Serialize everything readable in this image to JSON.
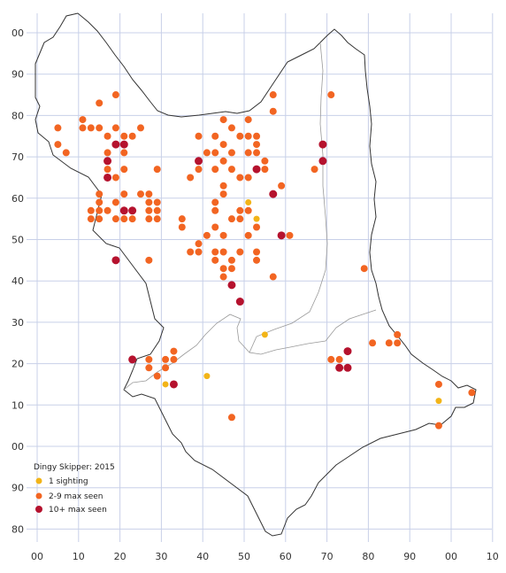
{
  "map": {
    "title": "Dingy Skipper:  2015",
    "x_ticks": [
      "00",
      "10",
      "20",
      "30",
      "40",
      "50",
      "60",
      "70",
      "80",
      "90",
      "00",
      "10"
    ],
    "y_ticks": [
      "00",
      "90",
      "80",
      "70",
      "60",
      "50",
      "40",
      "30",
      "20",
      "10",
      "00",
      "90",
      "80"
    ],
    "x_tick_values": [
      0,
      10,
      20,
      30,
      40,
      50,
      60,
      70,
      80,
      90,
      100,
      110
    ],
    "y_tick_values": [
      100,
      90,
      80,
      70,
      60,
      50,
      40,
      30,
      20,
      10,
      0,
      -10,
      -20
    ],
    "x_range": [
      -5,
      113
    ],
    "y_range": [
      -23,
      105
    ]
  },
  "legend": {
    "title": "Dingy Skipper:  2015",
    "items": [
      {
        "key": "one",
        "label": "1 sighting",
        "color": "#f2b418"
      },
      {
        "key": "few",
        "label": "2-9 max seen",
        "color": "#f26522"
      },
      {
        "key": "many",
        "label": "10+ max seen",
        "color": "#b5122e"
      }
    ]
  },
  "chart_data": {
    "type": "scatter",
    "title": "Dingy Skipper:  2015",
    "series": [
      {
        "name": "1 sighting",
        "color": "#f2b418",
        "points": [
          [
            51,
            59
          ],
          [
            53,
            55
          ],
          [
            55,
            27
          ],
          [
            41,
            17
          ],
          [
            31,
            15
          ],
          [
            97,
            11
          ]
        ]
      },
      {
        "name": "2-9 max seen",
        "color": "#f26522",
        "points": [
          [
            5,
            77
          ],
          [
            5,
            73
          ],
          [
            7,
            71
          ],
          [
            11,
            79
          ],
          [
            11,
            77
          ],
          [
            13,
            77
          ],
          [
            15,
            83
          ],
          [
            15,
            77
          ],
          [
            17,
            75
          ],
          [
            17,
            71
          ],
          [
            17,
            67
          ],
          [
            19,
            85
          ],
          [
            19,
            77
          ],
          [
            19,
            65
          ],
          [
            21,
            75
          ],
          [
            21,
            71
          ],
          [
            21,
            67
          ],
          [
            21,
            61
          ],
          [
            23,
            75
          ],
          [
            25,
            77
          ],
          [
            25,
            61
          ],
          [
            27,
            61
          ],
          [
            27,
            59
          ],
          [
            27,
            57
          ],
          [
            27,
            55
          ],
          [
            29,
            67
          ],
          [
            29,
            59
          ],
          [
            29,
            57
          ],
          [
            29,
            55
          ],
          [
            27,
            45
          ],
          [
            13,
            57
          ],
          [
            13,
            55
          ],
          [
            15,
            61
          ],
          [
            15,
            59
          ],
          [
            15,
            57
          ],
          [
            15,
            55
          ],
          [
            17,
            57
          ],
          [
            19,
            59
          ],
          [
            19,
            55
          ],
          [
            21,
            55
          ],
          [
            23,
            57
          ],
          [
            23,
            55
          ],
          [
            35,
            55
          ],
          [
            35,
            53
          ],
          [
            37,
            65
          ],
          [
            37,
            47
          ],
          [
            39,
            75
          ],
          [
            39,
            67
          ],
          [
            39,
            49
          ],
          [
            39,
            47
          ],
          [
            41,
            71
          ],
          [
            41,
            51
          ],
          [
            43,
            75
          ],
          [
            43,
            71
          ],
          [
            43,
            67
          ],
          [
            43,
            59
          ],
          [
            43,
            57
          ],
          [
            43,
            53
          ],
          [
            43,
            47
          ],
          [
            43,
            45
          ],
          [
            45,
            79
          ],
          [
            45,
            73
          ],
          [
            45,
            69
          ],
          [
            45,
            63
          ],
          [
            45,
            61
          ],
          [
            45,
            51
          ],
          [
            45,
            47
          ],
          [
            45,
            43
          ],
          [
            45,
            41
          ],
          [
            47,
            77
          ],
          [
            47,
            71
          ],
          [
            47,
            67
          ],
          [
            47,
            55
          ],
          [
            47,
            45
          ],
          [
            47,
            43
          ],
          [
            49,
            75
          ],
          [
            49,
            65
          ],
          [
            49,
            57
          ],
          [
            49,
            55
          ],
          [
            49,
            47
          ],
          [
            51,
            79
          ],
          [
            51,
            75
          ],
          [
            51,
            71
          ],
          [
            51,
            65
          ],
          [
            51,
            57
          ],
          [
            51,
            51
          ],
          [
            53,
            75
          ],
          [
            53,
            73
          ],
          [
            53,
            71
          ],
          [
            53,
            53
          ],
          [
            53,
            47
          ],
          [
            53,
            45
          ],
          [
            55,
            69
          ],
          [
            55,
            67
          ],
          [
            57,
            85
          ],
          [
            57,
            81
          ],
          [
            57,
            41
          ],
          [
            59,
            63
          ],
          [
            61,
            51
          ],
          [
            67,
            67
          ],
          [
            71,
            85
          ],
          [
            79,
            43
          ],
          [
            27,
            21
          ],
          [
            27,
            19
          ],
          [
            29,
            17
          ],
          [
            31,
            21
          ],
          [
            31,
            19
          ],
          [
            33,
            23
          ],
          [
            33,
            21
          ],
          [
            47,
            7
          ],
          [
            71,
            21
          ],
          [
            73,
            21
          ],
          [
            81,
            25
          ],
          [
            85,
            25
          ],
          [
            87,
            27
          ],
          [
            87,
            25
          ],
          [
            97,
            15
          ],
          [
            97,
            5
          ],
          [
            105,
            13
          ]
        ]
      },
      {
        "name": "10+ max seen",
        "color": "#b5122e",
        "points": [
          [
            17,
            69
          ],
          [
            17,
            65
          ],
          [
            19,
            73
          ],
          [
            21,
            73
          ],
          [
            19,
            45
          ],
          [
            21,
            57
          ],
          [
            23,
            57
          ],
          [
            23,
            21
          ],
          [
            33,
            15
          ],
          [
            39,
            69
          ],
          [
            47,
            39
          ],
          [
            49,
            35
          ],
          [
            53,
            67
          ],
          [
            57,
            61
          ],
          [
            59,
            51
          ],
          [
            69,
            73
          ],
          [
            69,
            69
          ],
          [
            73,
            19
          ],
          [
            75,
            19
          ],
          [
            75,
            23
          ]
        ]
      }
    ]
  }
}
